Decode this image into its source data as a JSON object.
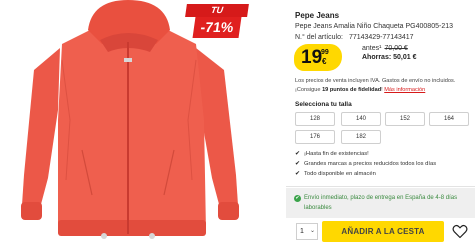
{
  "badge": {
    "title": "TU DESCUENTO",
    "value": "-71%"
  },
  "product": {
    "brand": "Pepe Jeans",
    "name": "Pepe Jeans Amalia Niño Chaqueta PG400805-213",
    "article_label": "N.° del artículo:",
    "article_value": "77143429-77143417"
  },
  "price": {
    "main": "19",
    "cents": "99",
    "currency": "€",
    "before_label": "antes¹",
    "before_value": "70,00 €",
    "save_label": "Ahorras: 50,01 €"
  },
  "notes": {
    "tax": "Los precios de venta incluyen IVA. Gastos de envío no incluidos.",
    "loyalty_prefix": "¡Consigue ",
    "loyalty_points": "19 puntos de fidelidad",
    "loyalty_suffix": "! ",
    "more_info": "Más información"
  },
  "sizes": {
    "title": "Selecciona tu talla",
    "options": [
      "128",
      "140",
      "152",
      "164",
      "176",
      "182"
    ]
  },
  "features": [
    "¡Hasta fin de existencias!",
    "Grandes marcas a precios reducidos todos los días",
    "Todo disponible en almacén"
  ],
  "delivery": {
    "text": "Envío inmediato, plazo de entrega en España de 4-8 días laborables"
  },
  "purchase": {
    "quantity": "1",
    "add_to_cart": "AÑADIR A LA CESTA"
  },
  "colors": {
    "accent_yellow": "#ffd800",
    "badge_red": "#e0201f",
    "delivery_green": "#3aa34a",
    "jacket": "#ee5a4a"
  }
}
